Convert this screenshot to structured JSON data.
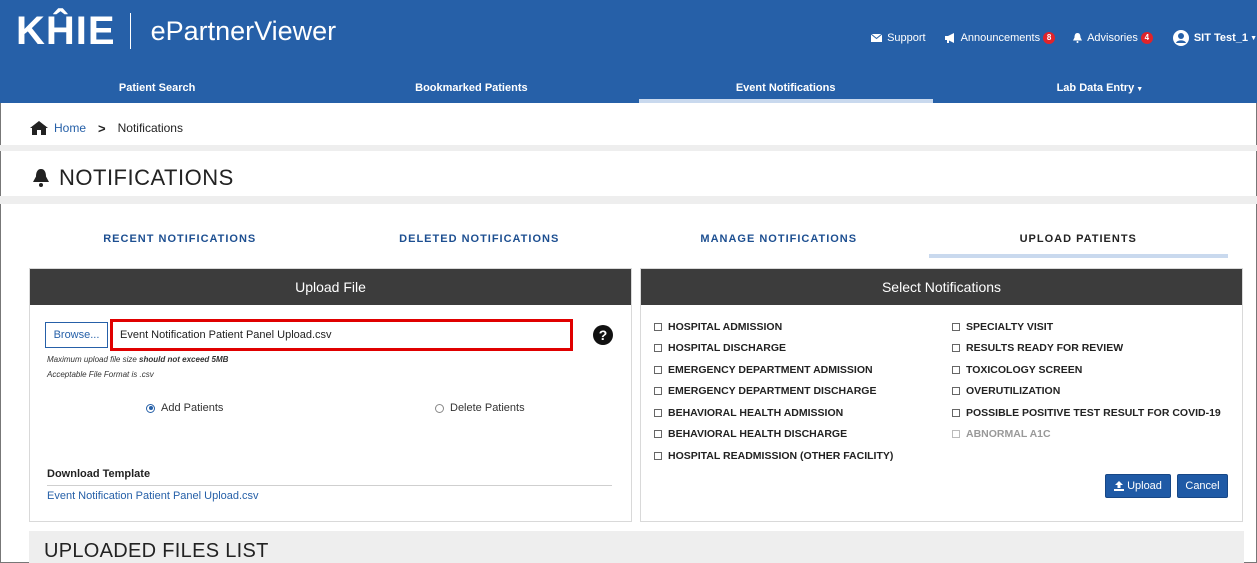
{
  "header": {
    "logo": "KĤIE",
    "app_name": "ePartnerViewer",
    "support": "Support",
    "announcements": "Announcements",
    "announcements_count": "8",
    "advisories": "Advisories",
    "advisories_count": "4",
    "user": "SIT Test_1"
  },
  "nav": {
    "items": [
      {
        "label": "Patient Search"
      },
      {
        "label": "Bookmarked Patients"
      },
      {
        "label": "Event Notifications"
      },
      {
        "label": "Lab Data Entry"
      }
    ],
    "active_index": 2
  },
  "breadcrumb": {
    "home": "Home",
    "current": "Notifications"
  },
  "page": {
    "title": "NOTIFICATIONS"
  },
  "subtabs": {
    "items": [
      "RECENT NOTIFICATIONS",
      "DELETED NOTIFICATIONS",
      "MANAGE NOTIFICATIONS",
      "UPLOAD PATIENTS"
    ],
    "active_index": 3
  },
  "upload_panel": {
    "title": "Upload File",
    "browse_label": "Browse...",
    "file_value": "Event Notification Patient Panel Upload.csv",
    "hint_size_prefix": "Maximum upload file size",
    "hint_size_bold": "should not exceed 5MB",
    "hint_format": "Acceptable File Format is .csv",
    "radio_add": "Add Patients",
    "radio_delete": "Delete Patients",
    "radio_selected": "add",
    "download_title": "Download Template",
    "download_link": "Event Notification Patient Panel Upload.csv"
  },
  "notify_panel": {
    "title": "Select Notifications",
    "left_options": [
      "HOSPITAL ADMISSION",
      "HOSPITAL DISCHARGE",
      "EMERGENCY DEPARTMENT ADMISSION",
      "EMERGENCY DEPARTMENT DISCHARGE",
      "BEHAVIORAL HEALTH ADMISSION",
      "BEHAVIORAL HEALTH DISCHARGE",
      "HOSPITAL READMISSION (OTHER FACILITY)"
    ],
    "right_options": [
      "SPECIALTY VISIT",
      "RESULTS READY FOR REVIEW",
      "TOXICOLOGY SCREEN",
      "OVERUTILIZATION",
      "POSSIBLE POSITIVE TEST RESULT FOR COVID-19",
      "ABNORMAL A1C"
    ],
    "upload_label": "Upload",
    "cancel_label": "Cancel"
  },
  "uploaded": {
    "title": "UPLOADED FILES LIST"
  },
  "colors": {
    "brand_blue": "#2660a8",
    "highlight_red": "#e00000",
    "panel_header": "#3c3c3c"
  }
}
